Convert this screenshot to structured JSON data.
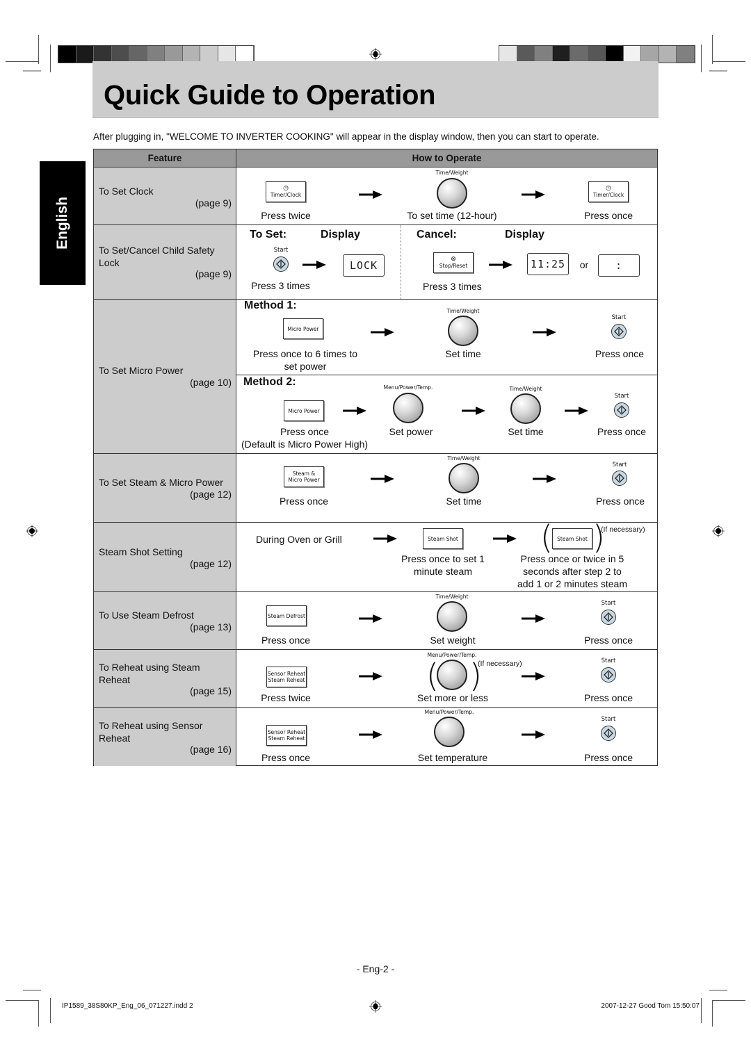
{
  "colors": {
    "title_band": "#cccccc",
    "header_band": "#999999",
    "feature_column": "#cccccc",
    "language_tab": "#000000",
    "start_button_fill": "#c9d9e3"
  },
  "print_marks": {
    "left_colorbar": [
      "#000000",
      "#1a1a1a",
      "#333333",
      "#4d4d4d",
      "#666666",
      "#808080",
      "#999999",
      "#b3b3b3",
      "#cccccc",
      "#e6e6e6",
      "#ffffff"
    ],
    "right_colorbar": [
      "#e6e6e6",
      "#5a5a5a",
      "#808080",
      "#1f1f1f",
      "#6b6b6b",
      "#575757",
      "#000000",
      "#f2f2f2",
      "#a6a6a6",
      "#b3b3b3",
      "#808080"
    ],
    "registration_icon": "crosshair-target"
  },
  "title": "Quick Guide to Operation",
  "intro": "After plugging in, \"WELCOME TO INVERTER COOKING\" will appear in the display window, then you can start to operate.",
  "language_tab": "English",
  "table": {
    "headers": {
      "feature": "Feature",
      "how": "How to Operate"
    },
    "rows": [
      {
        "feature": "To Set Clock",
        "page": "(page 9)",
        "steps": [
          {
            "icon": "timer-clock-button",
            "button_label": "Timer/Clock",
            "caption": "Press twice"
          },
          {
            "icon": "dial-knob",
            "knob_label": "Time/Weight",
            "caption": "To set time (12-hour)"
          },
          {
            "icon": "timer-clock-button",
            "button_label": "Timer/Clock",
            "caption": "Press once"
          }
        ]
      },
      {
        "feature": "To Set/Cancel Child Safety Lock",
        "page": "(page 9)",
        "set": {
          "heading": "To Set:",
          "display_heading": "Display",
          "start_label": "Start",
          "caption": "Press 3 times",
          "display_value": "LOCK"
        },
        "cancel": {
          "heading": "Cancel:",
          "display_heading": "Display",
          "button_label": "Stop/Reset",
          "caption": "Press 3 times",
          "display_value": "11:25",
          "or_text": "or",
          "alt_display_value": ":"
        }
      },
      {
        "feature": "To Set Micro Power",
        "page": "(page 10)",
        "method1": {
          "heading": "Method 1:",
          "steps": [
            {
              "button_label": "Micro Power",
              "caption_line1": "Press once to 6 times to",
              "caption_line2": "set power"
            },
            {
              "knob_label": "Time/Weight",
              "caption": "Set time"
            },
            {
              "start_label": "Start",
              "caption": "Press once"
            }
          ]
        },
        "method2": {
          "heading": "Method 2:",
          "steps": [
            {
              "button_label": "Micro Power",
              "caption": "Press once",
              "note": "(Default is Micro Power High)"
            },
            {
              "knob_label": "Menu/Power/Temp.",
              "caption": "Set power"
            },
            {
              "knob_label": "Time/Weight",
              "caption": "Set time"
            },
            {
              "start_label": "Start",
              "caption": "Press once"
            }
          ]
        }
      },
      {
        "feature": "To Set Steam & Micro Power",
        "page": "(page 12)",
        "steps": [
          {
            "button_label_line1": "Steam &",
            "button_label_line2": "Micro Power",
            "caption": "Press once"
          },
          {
            "knob_label": "Time/Weight",
            "caption": "Set time"
          },
          {
            "start_label": "Start",
            "caption": "Press once"
          }
        ]
      },
      {
        "feature": "Steam Shot Setting",
        "page": "(page 12)",
        "steps": [
          {
            "caption": "During Oven or Grill"
          },
          {
            "button_label": "Steam Shot",
            "caption_line1": "Press once to set 1",
            "caption_line2": "minute steam"
          },
          {
            "button_label": "Steam Shot",
            "note": "(If necessary)",
            "caption_line1": "Press once or twice in 5",
            "caption_line2": "seconds after step 2 to",
            "caption_line3": "add 1 or 2 minutes steam"
          }
        ]
      },
      {
        "feature": "To Use Steam Defrost",
        "page": "(page 13)",
        "steps": [
          {
            "button_label": "Steam Defrost",
            "caption": "Press once"
          },
          {
            "knob_label": "Time/Weight",
            "caption": "Set weight"
          },
          {
            "start_label": "Start",
            "caption": "Press once"
          }
        ]
      },
      {
        "feature": "To Reheat using Steam Reheat",
        "feature_line1": "To Reheat using Steam",
        "feature_line2": "Reheat",
        "page": "(page 15)",
        "steps": [
          {
            "button_label_line1": "Sensor Reheat",
            "button_label_line2": "Steam Reheat",
            "caption": "Press twice"
          },
          {
            "knob_label": "Menu/Power/Temp.",
            "note": "(If necessary)",
            "caption": "Set more or less"
          },
          {
            "start_label": "Start",
            "caption": "Press once"
          }
        ]
      },
      {
        "feature_line1": "To Reheat using Sensor",
        "feature_line2": "Reheat",
        "page": "(page 16)",
        "steps": [
          {
            "button_label_line1": "Sensor Reheat",
            "button_label_line2": "Steam Reheat",
            "caption": "Press once"
          },
          {
            "knob_label": "Menu/Power/Temp.",
            "caption": "Set temperature"
          },
          {
            "start_label": "Start",
            "caption": "Press once"
          }
        ]
      }
    ]
  },
  "child_lock_feature_line1": "To Set/Cancel Child Safety",
  "child_lock_feature_line2": "Lock",
  "page_number": "- Eng-2 -",
  "footer": {
    "left": "IP1589_38S80KP_Eng_06_071227.indd   2",
    "right": "2007-12-27   Good Tom 15:50:07"
  }
}
